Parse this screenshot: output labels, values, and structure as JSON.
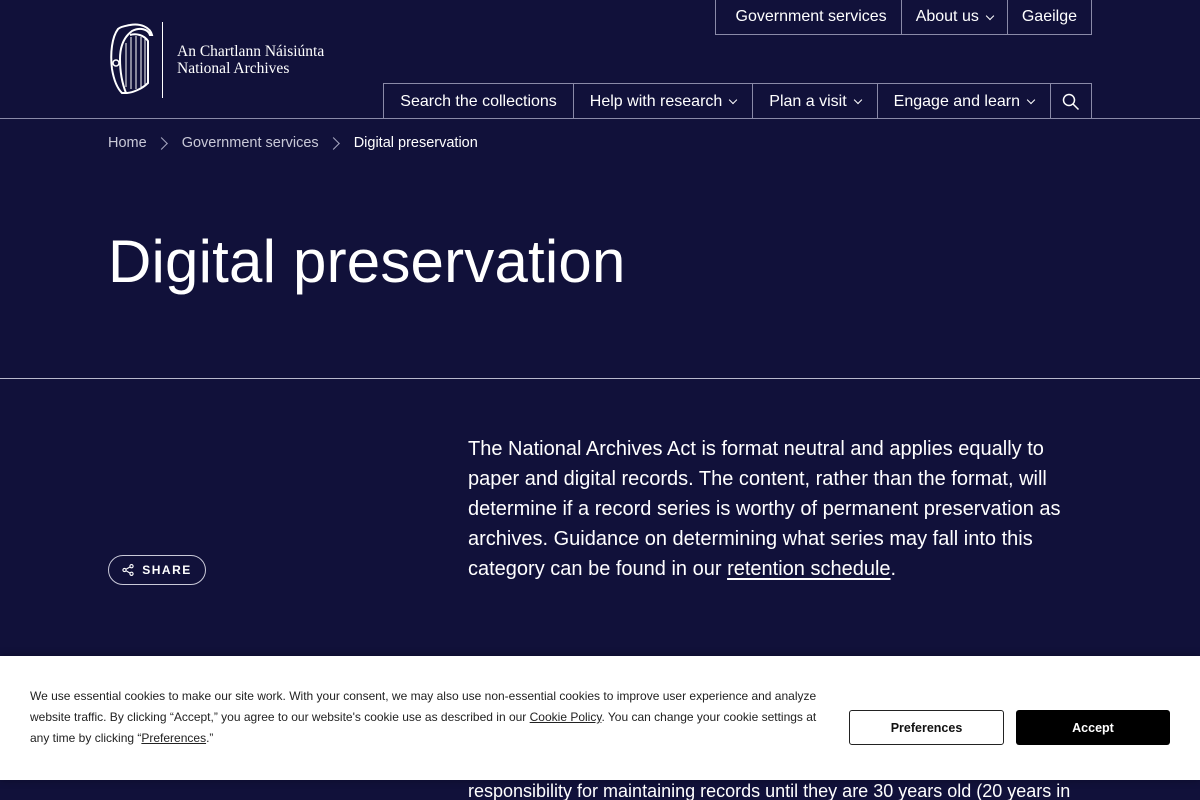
{
  "header": {
    "logo": {
      "line1": "An Chartlann Náisiúnta",
      "line2": "National Archives"
    },
    "utility_nav": [
      {
        "label": "Government services"
      },
      {
        "label": "About us",
        "icon": "chevron-down-icon"
      },
      {
        "label": "Gaeilge"
      }
    ],
    "main_nav": [
      {
        "label": "Search the collections"
      },
      {
        "label": "Help with research",
        "icon": "chevron-down-icon"
      },
      {
        "label": "Plan a visit",
        "icon": "chevron-down-icon"
      },
      {
        "label": "Engage and learn",
        "icon": "chevron-down-icon"
      }
    ],
    "search_icon": "search-icon"
  },
  "breadcrumb": {
    "items": [
      "Home",
      "Government services",
      "Digital preservation"
    ]
  },
  "page": {
    "title": "Digital preservation",
    "share_label": "SHARE",
    "intro_before_link": "The National Archives Act is format neutral and applies equally to paper and digital records. The content, rather than the format, will determine if a record series is worthy of permanent preservation as archives. Guidance on determining what series may fall into this category can be found in our ",
    "intro_link": "retention schedule",
    "intro_after_link": ".",
    "partial_text": "responsibility for maintaining records until they are 30 years old (20 years in"
  },
  "cookie_banner": {
    "text_1": "We use essential cookies to make our site work. With your consent, we may also use non-essential cookies to improve user experience and analyze website traffic. By clicking “Accept,” you agree to our website's cookie use as described in our ",
    "link_1": "Cookie Policy",
    "text_2": ". You can change your cookie settings at any time by clicking “",
    "link_2": "Preferences",
    "text_3": ".”",
    "preferences_label": "Preferences",
    "accept_label": "Accept"
  },
  "colors": {
    "background": "#11113a",
    "text": "#ffffff",
    "banner_bg": "#ffffff",
    "accept_bg": "#000000"
  }
}
